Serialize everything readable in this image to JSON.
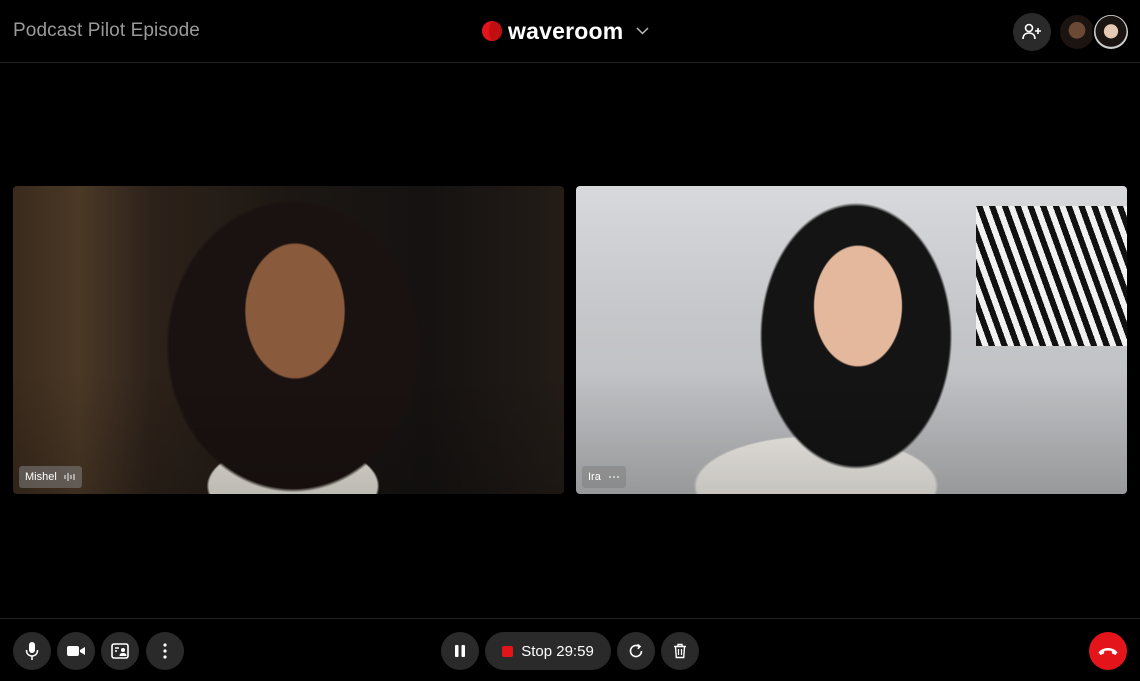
{
  "header": {
    "title": "Podcast Pilot Episode",
    "brand": "waveroom",
    "add_user_icon": "add-user-icon",
    "participants": [
      {
        "avatar": "avatar-mishel"
      },
      {
        "avatar": "avatar-ira"
      }
    ]
  },
  "tiles": [
    {
      "name": "Mishel",
      "status_icon": "audio-level-icon"
    },
    {
      "name": "Ira",
      "status_icon": "more-dots-icon"
    }
  ],
  "footer": {
    "left_controls": [
      "microphone-icon",
      "camera-icon",
      "screen-share-icon",
      "more-vertical-icon"
    ],
    "center": {
      "pause_icon": "pause-icon",
      "stop_label": "Stop 29:59",
      "restart_icon": "restart-icon",
      "delete_icon": "trash-icon"
    },
    "hangup_icon": "phone-hangup-icon"
  },
  "colors": {
    "accent": "#e3151a",
    "background": "#000000",
    "control_bg": "#2a2a2a",
    "title_text": "#9a9a9a"
  }
}
